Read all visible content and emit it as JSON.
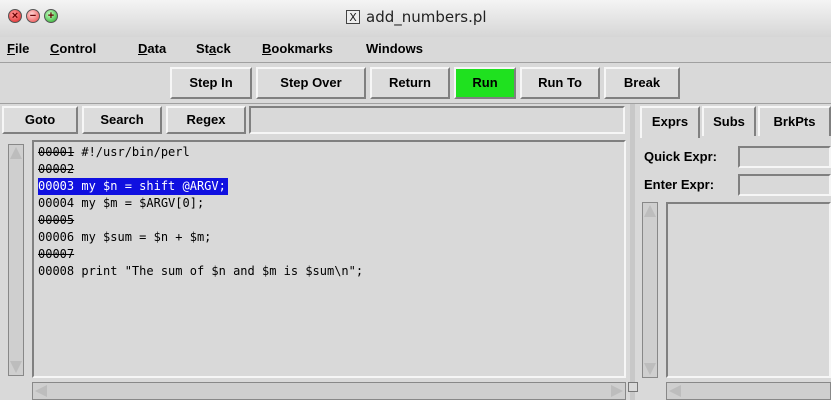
{
  "window": {
    "title": "add_numbers.pl",
    "x11_glyph": "X",
    "controls": {
      "close": "×",
      "minimize": "−",
      "zoom": "+"
    }
  },
  "menu": [
    {
      "label": "File",
      "ul": "F",
      "rest": "ile"
    },
    {
      "label": "Control",
      "ul": "C",
      "rest": "ontrol"
    },
    {
      "label": "Data",
      "ul": "D",
      "rest": "ata"
    },
    {
      "label": "Stack",
      "pre": "St",
      "ul": "a",
      "rest": "ck"
    },
    {
      "label": "Bookmarks",
      "ul": "B",
      "rest": "ookmarks"
    },
    {
      "label": "Windows",
      "ul": "",
      "rest": "Windows"
    }
  ],
  "toolbar": {
    "step_in": "Step In",
    "step_over": "Step Over",
    "return": "Return",
    "run": "Run",
    "run_to": "Run To",
    "break": "Break",
    "run_color": "#1fe11f"
  },
  "left": {
    "goto": "Goto",
    "search": "Search",
    "regex": "Regex",
    "search_value": ""
  },
  "code": {
    "highlight_color": "#1010e0",
    "lines": [
      {
        "num": "00001",
        "text": " #!/usr/bin/perl",
        "breakable": false,
        "highlighted": false
      },
      {
        "num": "00002",
        "text": "",
        "breakable": false,
        "highlighted": false
      },
      {
        "num": "00003",
        "text": " my $n = shift @ARGV;",
        "breakable": true,
        "highlighted": true
      },
      {
        "num": "00004",
        "text": " my $m = $ARGV[0];",
        "breakable": true,
        "highlighted": false
      },
      {
        "num": "00005",
        "text": "",
        "breakable": false,
        "highlighted": false
      },
      {
        "num": "00006",
        "text": " my $sum = $n + $m;",
        "breakable": true,
        "highlighted": false
      },
      {
        "num": "00007",
        "text": "",
        "breakable": false,
        "highlighted": false
      },
      {
        "num": "00008",
        "text": " print \"The sum of $n and $m is $sum\\n\";",
        "breakable": true,
        "highlighted": false
      }
    ]
  },
  "right": {
    "tabs": [
      "Exprs",
      "Subs",
      "BrkPts"
    ],
    "active_tab": "Exprs",
    "quick_expr_label": "Quick Expr:",
    "enter_expr_label": "Enter Expr:",
    "quick_expr_value": "",
    "enter_expr_value": ""
  }
}
